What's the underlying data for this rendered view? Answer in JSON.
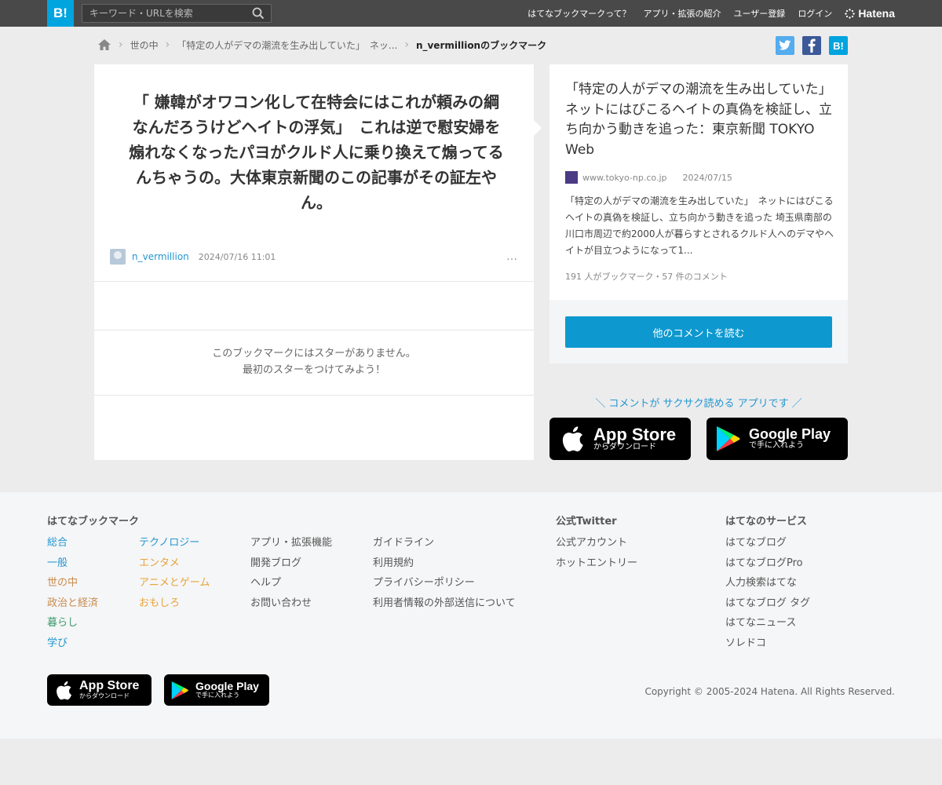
{
  "header": {
    "logo": "B!",
    "search_placeholder": "キーワード・URLを検索",
    "nav": [
      "はてなブックマークって？",
      "アプリ・拡張の紹介",
      "ユーザー登録",
      "ログイン"
    ],
    "brand": "Hatena"
  },
  "breadcrumb": {
    "items": [
      "世の中",
      "「特定の人がデマの潮流を生み出していた」　ネッ..."
    ],
    "current": "n_vermillionのブックマーク"
  },
  "share": {
    "twitter_color": "#55acee",
    "facebook_color": "#3b5998",
    "hatena_color": "#00a4de",
    "hatena_label": "B!"
  },
  "comment": {
    "text": "「 嫌韓がオワコン化して在特会にはこれが頼みの綱なんだろうけどヘイトの浮気」　これは逆で慰安婦を煽れなくなったパヨがクルド人に乗り換えて煽ってるんちゃうの。大体東京新聞のこの記事がその証左やん。",
    "username": "n_vermillion",
    "datetime": "2024/07/16 11:01",
    "more": "…",
    "stars_line1": "このブックマークにはスターがありません。",
    "stars_line2": "最初のスターをつけてみよう！"
  },
  "article": {
    "title": "「特定の人がデマの潮流を生み出していた」　ネットにはびこるヘイトの真偽を検証し、立ち向かう動きを追った：東京新聞 TOKYO Web",
    "domain": "www.tokyo-np.co.jp",
    "date": "2024/07/15",
    "summary": "「特定の人がデマの潮流を生み出していた」　ネットにはびこるヘイトの真偽を検証し、立ち向かう動きを追った 埼玉県南部の川口市周辺で約2000人が暮らすとされるクルド人へのデマやヘイトが目立つようになって1...",
    "counts": "191 人がブックマーク・57 件のコメント",
    "read_button": "他のコメントを読む"
  },
  "promo": {
    "text": "＼ コメントが サクサク読める アプリです ／",
    "appstore_big": "App Store",
    "appstore_small": "からダウンロード",
    "googleplay_big": "Google Play",
    "googleplay_small": "で手に入れよう"
  },
  "footer": {
    "col1_heading": "はてなブックマーク",
    "col1": [
      {
        "label": "総合",
        "color": "#2496cf"
      },
      {
        "label": "一般",
        "color": "#2496cf"
      },
      {
        "label": "世の中",
        "color": "#c98a4b"
      },
      {
        "label": "政治と経済",
        "color": "#c98a4b"
      },
      {
        "label": "暮らし",
        "color": "#3a9a6a"
      },
      {
        "label": "学び",
        "color": "#2496cf"
      }
    ],
    "col2": [
      {
        "label": "テクノロジー",
        "color": "#2496cf"
      },
      {
        "label": "エンタメ",
        "color": "#e8a33a"
      },
      {
        "label": "アニメとゲーム",
        "color": "#e8a33a"
      },
      {
        "label": "おもしろ",
        "color": "#e8a33a"
      }
    ],
    "col3": [
      "アプリ・拡張機能",
      "開発ブログ",
      "ヘルプ",
      "お問い合わせ"
    ],
    "col4": [
      "ガイドライン",
      "利用規約",
      "プライバシーポリシー",
      "利用者情報の外部送信について"
    ],
    "twitter_heading": "公式Twitter",
    "twitter_links": [
      "公式アカウント",
      "ホットエントリー"
    ],
    "services_heading": "はてなのサービス",
    "services": [
      "はてなブログ",
      "はてなブログPro",
      "人力検索はてな",
      "はてなブログ タグ",
      "はてなニュース",
      "ソレドコ"
    ],
    "copyright": "Copyright © 2005-2024 Hatena. All Rights Reserved."
  }
}
